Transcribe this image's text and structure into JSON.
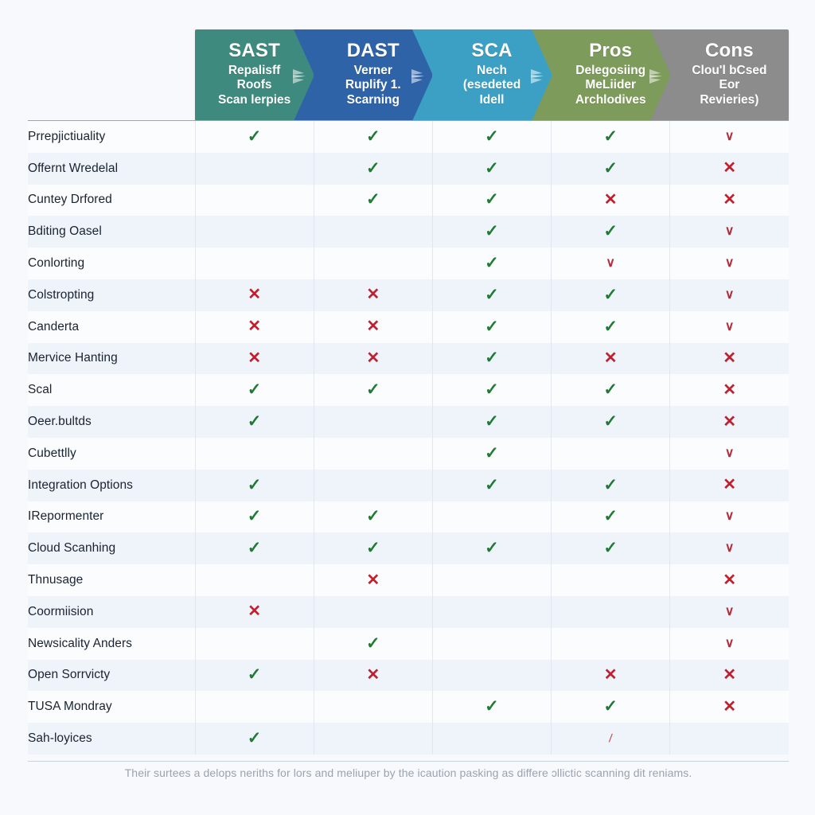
{
  "colors": {
    "page_background": "#f8f9fc",
    "header_sast": "#3f8a7e",
    "header_dast": "#2f63a8",
    "header_sca": "#3ba0c4",
    "header_pros": "#7d9b5a",
    "header_cons": "#8c8c8c",
    "check_green": "#1f7a33",
    "cross_red": "#c21f2e",
    "row_stripe": "#eff4fb",
    "row_base": "#fbfcfe"
  },
  "header": {
    "columns": [
      {
        "title": "SAST",
        "subtitle_lines": [
          "Repalisff",
          "Roofs",
          "Scan lerpies"
        ],
        "color": "#3f8a7e",
        "has_arrow": true
      },
      {
        "title": "DAST",
        "subtitle_lines": [
          "Verner",
          "Ruplify 1.",
          "Scarning"
        ],
        "color": "#2f63a8",
        "has_arrow": true
      },
      {
        "title": "SCA",
        "subtitle_lines": [
          "Nech",
          "(esedeted",
          "Idell"
        ],
        "color": "#3ba0c4",
        "has_arrow": true
      },
      {
        "title": "Pros",
        "subtitle_lines": [
          "Delegosiing",
          "MeLiider",
          "Archlodives"
        ],
        "color": "#7d9b5a",
        "has_arrow": true
      },
      {
        "title": "Cons",
        "subtitle_lines": [
          "Clou'l bCsed",
          "Eor",
          "Revieries)"
        ],
        "color": "#8c8c8c",
        "has_arrow": false
      }
    ]
  },
  "chart_data": {
    "type": "table",
    "title": "",
    "columns": [
      "SAST",
      "DAST",
      "SCA",
      "Pros",
      "Cons"
    ],
    "row_label_header": "",
    "legend": [
      {
        "symbol": "check",
        "meaning": "supported",
        "color": "#1f7a33"
      },
      {
        "symbol": "cross",
        "meaning": "not supported",
        "color": "#c21f2e"
      },
      {
        "symbol": "blank",
        "meaning": "not applicable",
        "color": ""
      }
    ],
    "rows": [
      {
        "label": "Prrepjictiuality",
        "values": [
          "yes",
          "yes",
          "yes",
          "yes",
          "weak"
        ]
      },
      {
        "label": "Offernt Wredelal",
        "values": [
          "blank",
          "yes",
          "yes",
          "yes",
          "no"
        ]
      },
      {
        "label": "Cuntey Drfored",
        "values": [
          "blank",
          "yes",
          "yes",
          "no",
          "no"
        ]
      },
      {
        "label": "Bditing Oasel",
        "values": [
          "blank",
          "blank",
          "yes",
          "yes",
          "weak"
        ]
      },
      {
        "label": "Conlorting",
        "values": [
          "blank",
          "blank",
          "yes",
          "weak",
          "weak"
        ]
      },
      {
        "label": "Colstropting",
        "values": [
          "no",
          "no",
          "yes",
          "yes",
          "weak"
        ]
      },
      {
        "label": "Canderta",
        "values": [
          "no",
          "no",
          "yes",
          "yes",
          "weak"
        ]
      },
      {
        "label": "Mervice Hanting",
        "values": [
          "no",
          "no",
          "yes",
          "no",
          "no"
        ]
      },
      {
        "label": "Scal",
        "values": [
          "yes",
          "yes",
          "yes",
          "yes",
          "no"
        ]
      },
      {
        "label": "Oeer.bultds",
        "values": [
          "yes",
          "blank",
          "yes",
          "yes",
          "no"
        ]
      },
      {
        "label": "Cubettlly",
        "values": [
          "blank",
          "blank",
          "yes",
          "blank",
          "weak"
        ]
      },
      {
        "label": "Integration Options",
        "values": [
          "yes",
          "blank",
          "yes",
          "yes",
          "no"
        ]
      },
      {
        "label": "IRepormenter",
        "values": [
          "yes",
          "yes",
          "blank",
          "yes",
          "weak"
        ]
      },
      {
        "label": "Cloud Scanhing",
        "values": [
          "yes",
          "yes",
          "yes",
          "yes",
          "weak"
        ]
      },
      {
        "label": "Thnusage",
        "values": [
          "blank",
          "no",
          "blank",
          "blank",
          "no"
        ]
      },
      {
        "label": "Coormiision",
        "values": [
          "no",
          "blank",
          "blank",
          "blank",
          "weak"
        ]
      },
      {
        "label": "Newsicality Anders",
        "values": [
          "blank",
          "yes",
          "blank",
          "blank",
          "weak"
        ]
      },
      {
        "label": "Open Sorrvicty",
        "values": [
          "yes",
          "no",
          "blank",
          "no",
          "no"
        ]
      },
      {
        "label": "TUSA Mondray",
        "values": [
          "blank",
          "blank",
          "yes",
          "yes",
          "no"
        ]
      },
      {
        "label": "Sah-loyices",
        "values": [
          "yes",
          "blank",
          "blank",
          "faint",
          "blank"
        ]
      }
    ]
  },
  "footer": {
    "note": "Their surtees a delops neriths for lors and meliuper by the icaution pasking as differe ɔllictic scanning dit reniams."
  },
  "glyphs": {
    "yes": "✓",
    "no": "✕",
    "weak": "∨",
    "faint": "∕",
    "blank": ""
  }
}
